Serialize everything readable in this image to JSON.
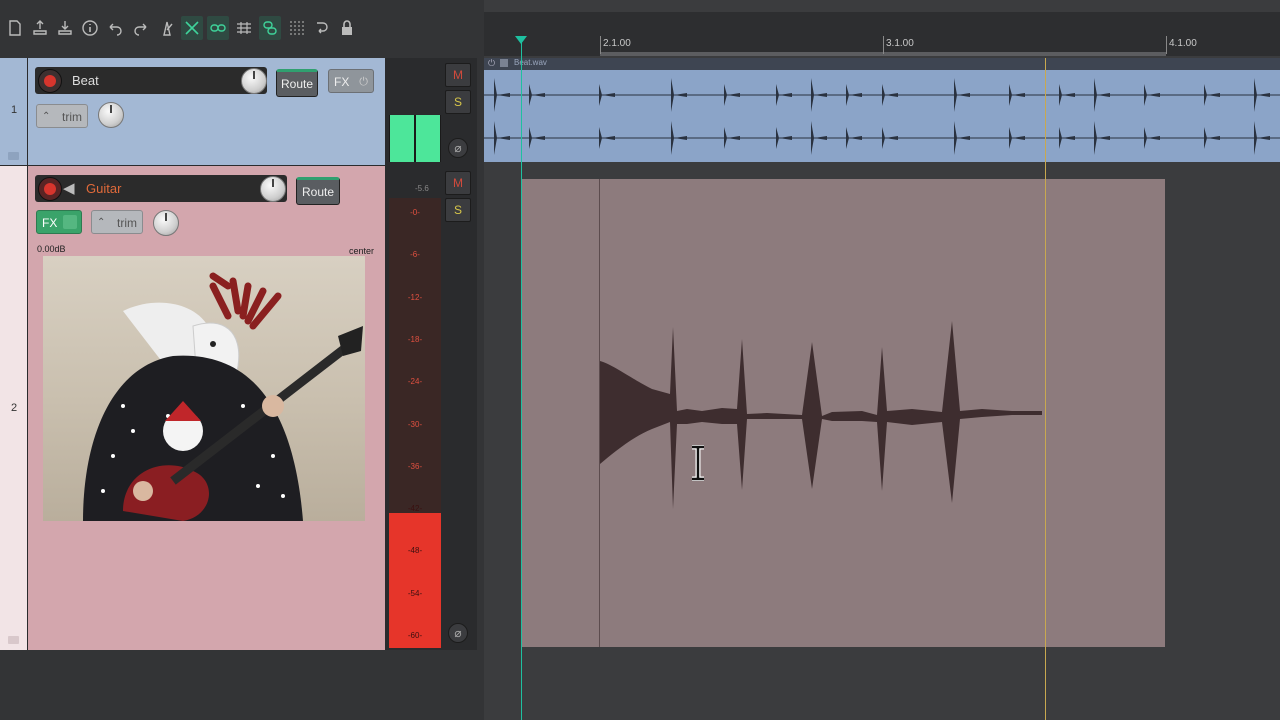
{
  "toolbar": {
    "icons": [
      "new-project-icon",
      "save-icon",
      "open-icon",
      "info-icon",
      "undo-icon",
      "redo-icon",
      "metronome-icon",
      "ripple-edit-icon",
      "grouping-icon",
      "snap-grid-icon",
      "link-icon",
      "grid-dots-icon",
      "loop-icon",
      "lock-icon"
    ]
  },
  "tracks": [
    {
      "number": "1",
      "name": "Beat",
      "route_label": "Route",
      "fx_label": "FX",
      "trim_label": "trim",
      "color": "#a3b8d4"
    },
    {
      "number": "2",
      "name": "Guitar",
      "route_label": "Route",
      "fx_label": "FX",
      "trim_label": "trim",
      "volume_text": "0.00dB",
      "pan_text": "center",
      "color": "#d3a6ad"
    }
  ],
  "mixer": {
    "mute_label": "M",
    "solo_label": "S",
    "phase_symbol": "⌀",
    "peak_readout": "-5.6",
    "meter_scale": [
      "-0-",
      "-6-",
      "-12-",
      "-18-",
      "-24-",
      "-30-",
      "-36-",
      "-42-",
      "-48-",
      "-54-",
      "-60-"
    ],
    "track1_meter_level": 1.0,
    "track2_meter_level": 0.3
  },
  "ruler": {
    "markers": [
      "2.1.00",
      "3.1.00",
      "4.1.00"
    ]
  },
  "items": {
    "beat_item_name": "Beat.wav"
  },
  "colors": {
    "beat_track": "#a3b8d4",
    "guitar_track": "#d3a6ad",
    "guitar_item": "#8d7b7d",
    "meter_green": "#4de69a",
    "meter_red": "#e6352a",
    "cursor": "#1ec0a0"
  }
}
